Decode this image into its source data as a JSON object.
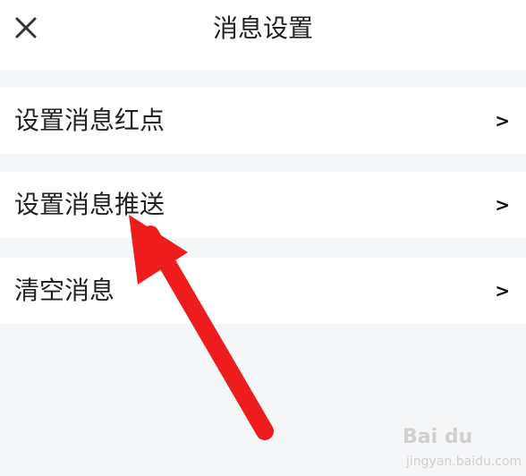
{
  "header": {
    "title": "消息设置",
    "close_icon": "close-icon"
  },
  "settings": {
    "items": [
      {
        "label": "设置消息红点",
        "chevron": ">"
      },
      {
        "label": "设置消息推送",
        "chevron": ">"
      },
      {
        "label": "清空消息",
        "chevron": ">"
      }
    ]
  },
  "annotation": {
    "arrow_color": "#ee1c1c"
  },
  "watermark": {
    "brand": "Bai du",
    "sub": "jingyan.baidu.com"
  },
  "colors": {
    "background": "#f5f6f8",
    "row_background": "#ffffff",
    "text": "#222222"
  }
}
